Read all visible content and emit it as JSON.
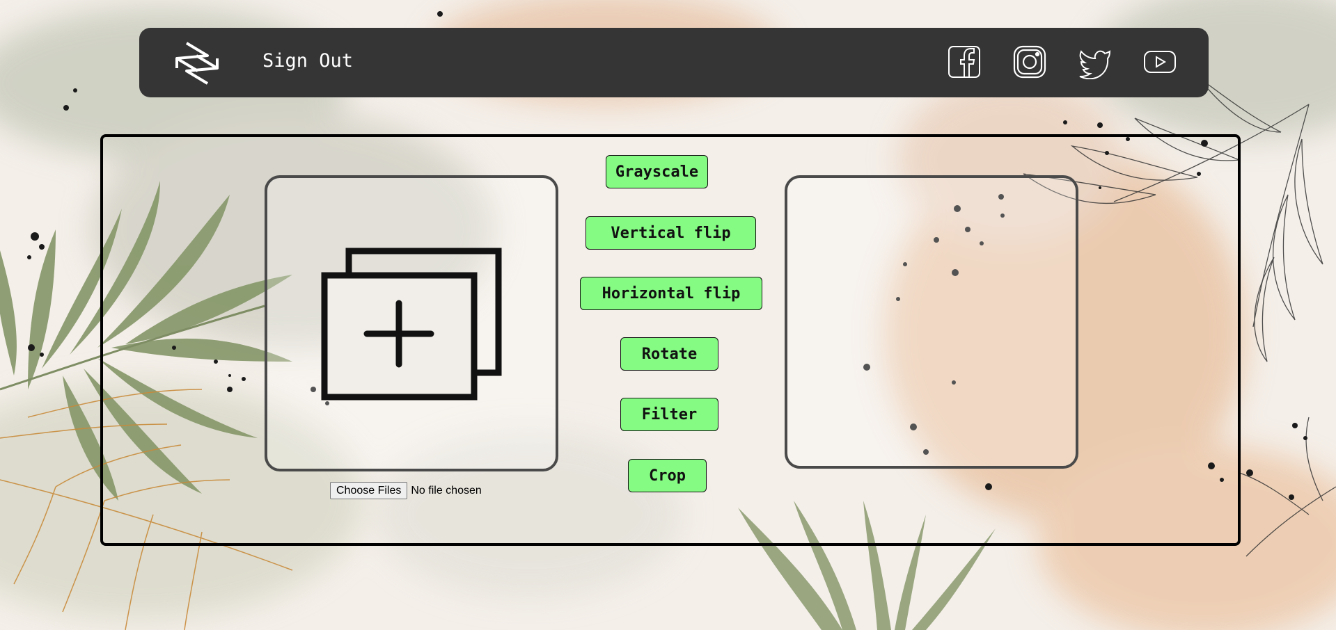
{
  "header": {
    "logo_icon": "abstract-s-logo",
    "sign_out_label": "Sign Out",
    "social_icons": [
      "facebook-icon",
      "instagram-icon",
      "twitter-icon",
      "youtube-icon"
    ]
  },
  "editor": {
    "upload_panel_icon": "add-image-icon",
    "buttons": {
      "grayscale": "Grayscale",
      "vertical_flip": "Vertical flip",
      "horizontal_flip": "Horizontal flip",
      "rotate": "Rotate",
      "filter": "Filter",
      "crop": "Crop"
    },
    "file_input": {
      "button_label": "Choose Files",
      "status": "No file chosen"
    }
  },
  "colors": {
    "navbar": "#353535",
    "button": "#85fb84",
    "background": "#f4efe9"
  }
}
